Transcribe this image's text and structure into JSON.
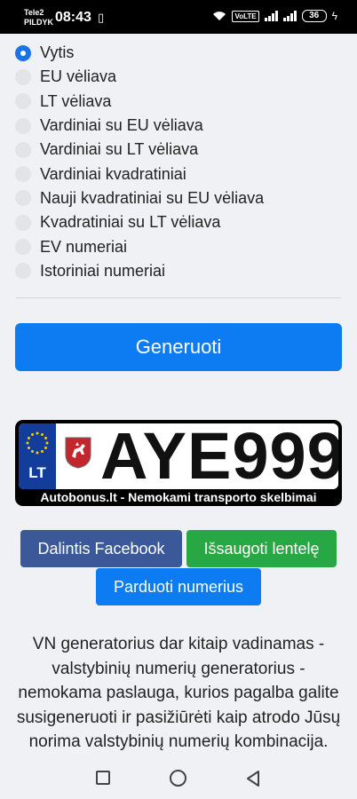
{
  "status_bar": {
    "carrier_line1": "Tele2",
    "carrier_line2": "PILDYK",
    "time": "08:43",
    "volte": "VoLTE",
    "battery": "36"
  },
  "plate_types": [
    {
      "label": "Vytis",
      "selected": true
    },
    {
      "label": "EU vėliava",
      "selected": false
    },
    {
      "label": "LT vėliava",
      "selected": false
    },
    {
      "label": "Vardiniai su EU vėliava",
      "selected": false
    },
    {
      "label": "Vardiniai su LT vėliava",
      "selected": false
    },
    {
      "label": "Vardiniai kvadratiniai",
      "selected": false
    },
    {
      "label": "Nauji kvadratiniai su EU vėliava",
      "selected": false
    },
    {
      "label": "Kvadratiniai su LT vėliava",
      "selected": false
    },
    {
      "label": "EV numeriai",
      "selected": false
    },
    {
      "label": "Istoriniai numeriai",
      "selected": false
    }
  ],
  "generate_label": "Generuoti",
  "plate": {
    "country_code": "LT",
    "number": "AYE999",
    "caption": "Autobonus.lt - Nemokami transporto skelbimai"
  },
  "actions": {
    "facebook_label": "Dalintis Facebook",
    "save_label": "Išsaugoti lentelę",
    "sell_label": "Parduoti numerius"
  },
  "description": "VN generatorius dar kitaip vadinamas - valstybinių numerių generatorius - nemokama paslauga, kurios pagalba galite susigeneruoti ir pasižiūrėti kaip atrodo Jūsų norima valstybinių numerių kombinacija. VIRVN | Automobilio",
  "colors": {
    "primary": "#0d7bf2",
    "facebook": "#3b5998",
    "success": "#28a745",
    "eu_blue": "#123d9a"
  }
}
